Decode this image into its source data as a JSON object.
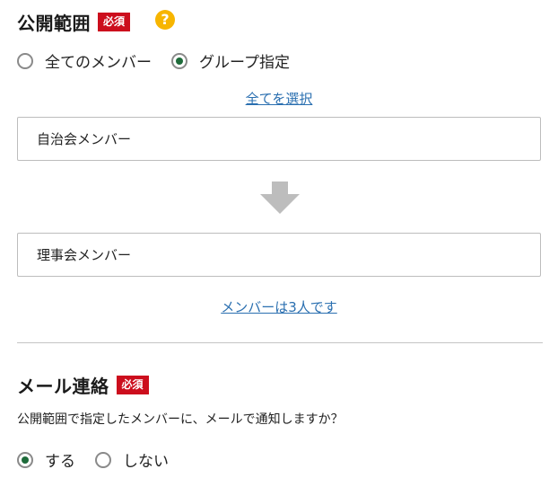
{
  "visibility": {
    "title": "公開範囲",
    "required_label": "必須",
    "help_icon": "question-mark-icon",
    "help_glyph": "?",
    "options": [
      {
        "label": "全てのメンバー",
        "checked": false
      },
      {
        "label": "グループ指定",
        "checked": true
      }
    ],
    "select_all_link": "全てを選択",
    "source_group": "自治会メンバー",
    "arrow_icon": "down-arrow-icon",
    "target_group": "理事会メンバー",
    "member_count_link": "メンバーは3人です"
  },
  "mail": {
    "title": "メール連絡",
    "required_label": "必須",
    "question": "公開範囲で指定したメンバーに、メールで通知しますか？",
    "options": [
      {
        "label": "する",
        "checked": true
      },
      {
        "label": "しない",
        "checked": false
      }
    ]
  },
  "colors": {
    "required_badge": "#cc0e1d",
    "help_icon": "#f7b500",
    "radio_checked": "#1e6b3a",
    "link": "#2a6fb0",
    "arrow": "#bdbdbd"
  }
}
